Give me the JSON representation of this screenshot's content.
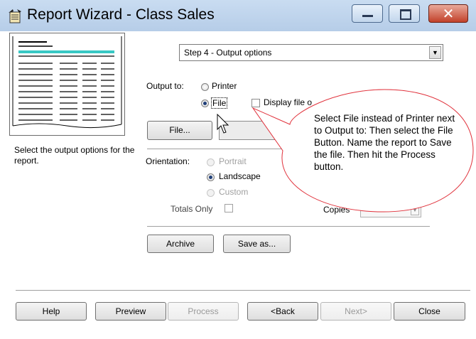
{
  "window": {
    "title": "Report Wizard - Class Sales"
  },
  "step_select": {
    "value": "Step 4 - Output options"
  },
  "sidebar": {
    "help_text": "Select the output options for the report."
  },
  "output": {
    "label": "Output to:",
    "printer_label": "Printer",
    "file_label": "File",
    "selected": "File",
    "display_label": "Display file o"
  },
  "file_button": {
    "label": "File..."
  },
  "orientation": {
    "label": "Orientation:",
    "portrait": "Portrait",
    "landscape": "Landscape",
    "custom": "Custom",
    "selected": "Landscape"
  },
  "totals_only": {
    "label": "Totals Only",
    "checked": false
  },
  "copies": {
    "label": "Copies"
  },
  "archive_button": {
    "label": "Archive"
  },
  "save_as_button": {
    "label": "Save as..."
  },
  "footer": {
    "help": "Help",
    "preview": "Preview",
    "process": "Process",
    "back": "<Back",
    "next": "Next>",
    "close": "Close"
  },
  "callout": {
    "text": "Select File instead of Printer next to Output to: Then select the File Button. Name the report to Save the file. Then hit the Process button."
  },
  "colors": {
    "titlebar": "#c4d9f0",
    "close_button": "#c2412a",
    "callout_border": "#e0303a",
    "radio_dot": "#1f3e78"
  },
  "icons": [
    "report-wizard-icon",
    "minimize-icon",
    "maximize-icon",
    "close-icon",
    "dropdown-arrow-icon",
    "mouse-cursor-icon"
  ]
}
